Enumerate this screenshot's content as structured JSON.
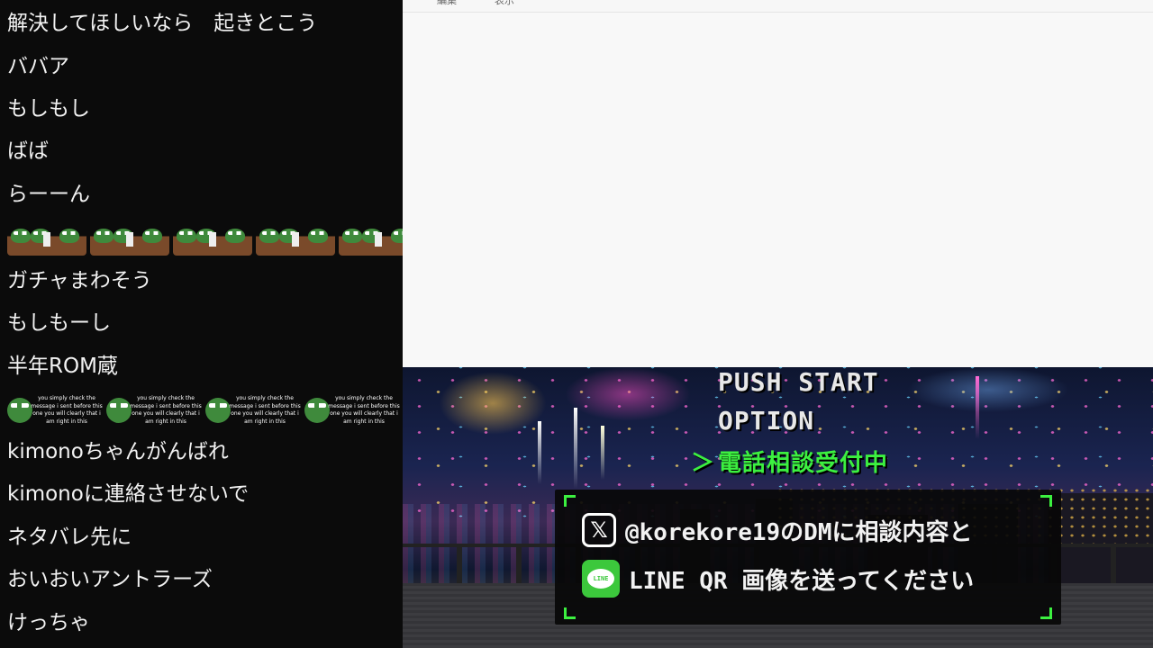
{
  "chat": {
    "messages": [
      "解決してほしいなら　起きとこう",
      "ババア",
      "もしもし",
      "ばば",
      "らーーん",
      "ガチャまわそう",
      "もしもーし",
      "半年ROM蔵",
      "kimonoちゃんがんばれ",
      "kimonoに連絡させないで",
      "ネタバレ先に",
      "おいおいアントラーズ",
      "けっちゃ"
    ],
    "emote_caption": "you simply check the message i sent before this one you will clearly that i am right in this"
  },
  "menu": {
    "edit": "編集",
    "view": "表示"
  },
  "game": {
    "push_start": "PUSH START",
    "option": "OPTION",
    "cursor": "＞",
    "consult": "電話相談受付中",
    "dialog_line1": "@korekore19のDMに相談内容と",
    "dialog_line2": "LINE QR 画像を送ってください",
    "x_glyph": "𝕏",
    "line_glyph": "LINE",
    "accent": "#3cf040"
  }
}
